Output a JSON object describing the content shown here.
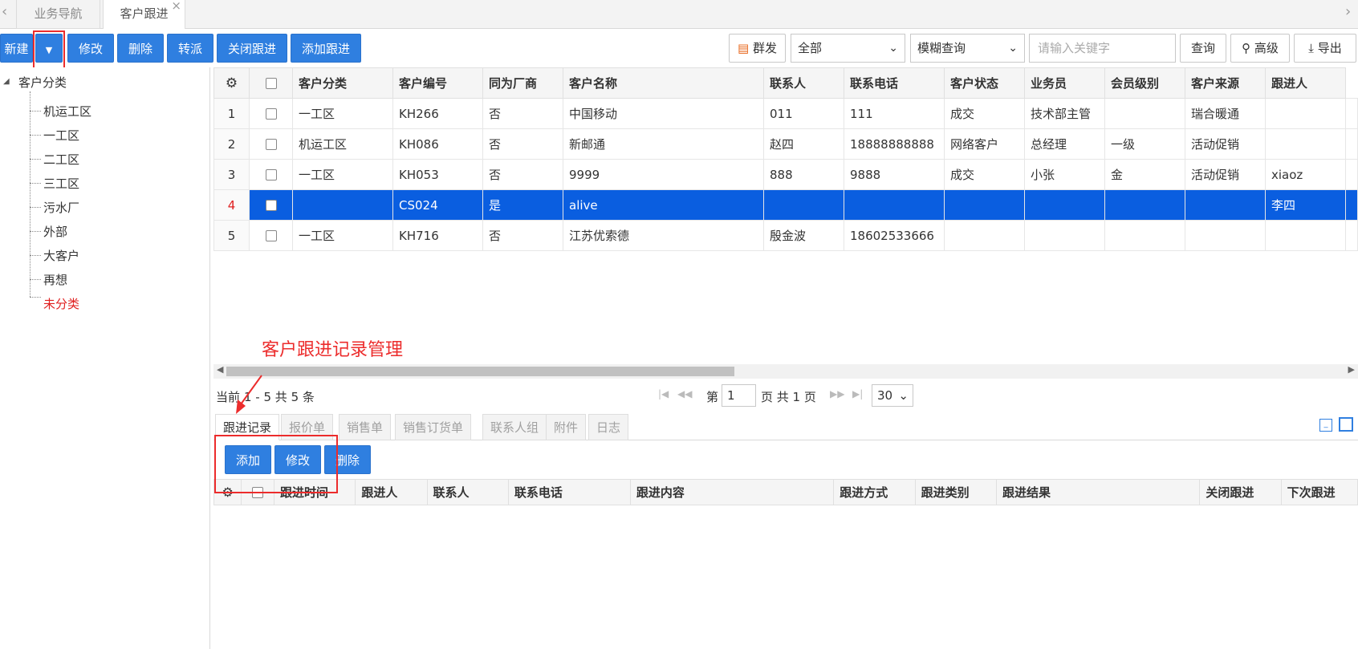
{
  "tabs": [
    {
      "label": "业务导航"
    },
    {
      "label": "客户跟进"
    }
  ],
  "toolbar": {
    "new": "新建",
    "edit": "修改",
    "delete": "删除",
    "transfer": "转派",
    "close_follow": "关闭跟进",
    "add_follow": "添加跟进",
    "mass_send": "群发",
    "scope_select": "全部",
    "query_mode_select": "模糊查询",
    "keyword_placeholder": "请输入关键字",
    "query": "查询",
    "advanced": "高级",
    "export": "导出"
  },
  "tree": {
    "root": "客户分类",
    "items": [
      "机运工区",
      "一工区",
      "二工区",
      "三工区",
      "污水厂",
      "外部",
      "大客户",
      "再想",
      "未分类"
    ]
  },
  "grid": {
    "columns": [
      "客户分类",
      "客户编号",
      "同为厂商",
      "客户名称",
      "联系人",
      "联系电话",
      "客户状态",
      "业务员",
      "会员级别",
      "客户来源",
      "跟进人"
    ],
    "rows": [
      {
        "num": "1",
        "cells": [
          "一工区",
          "KH266",
          "否",
          "中国移动",
          "011",
          "111",
          "成交",
          "技术部主管",
          "",
          "瑞合暖通",
          ""
        ]
      },
      {
        "num": "2",
        "cells": [
          "机运工区",
          "KH086",
          "否",
          "新邮通",
          "赵四",
          "18888888888",
          "网络客户",
          "总经理",
          "一级",
          "活动促销",
          ""
        ]
      },
      {
        "num": "3",
        "cells": [
          "一工区",
          "KH053",
          "否",
          "9999",
          "888",
          "9888",
          "成交",
          "小张",
          "金",
          "活动促销",
          "xiaoz"
        ]
      },
      {
        "num": "4",
        "cells": [
          "",
          "CS024",
          "是",
          "alive",
          "",
          "",
          "",
          "",
          "",
          "",
          "李四"
        ]
      },
      {
        "num": "5",
        "cells": [
          "一工区",
          "KH716",
          "否",
          "江苏优索德",
          "殷金波",
          "18602533666",
          "",
          "",
          "",
          "",
          ""
        ]
      }
    ]
  },
  "pager": {
    "summary_prefix": "当前",
    "summary_range": "1 - 5 共 5 条",
    "page_label": "第",
    "page_value": "1",
    "page_suffix": "页 共 1 页",
    "page_size": "30"
  },
  "annotation": "客户跟进记录管理",
  "bottom": {
    "tabs": [
      "跟进记录",
      "报价单",
      "销售单",
      "销售订货单",
      "联系人组",
      "附件",
      "日志"
    ],
    "add": "添加",
    "edit": "修改",
    "delete": "删除",
    "columns": [
      "跟进时间",
      "跟进人",
      "联系人",
      "联系电话",
      "跟进内容",
      "跟进方式",
      "跟进类别",
      "跟进结果",
      "关闭跟进",
      "下次跟进"
    ]
  },
  "colors": {
    "primary": "#2f7fe0",
    "selected_row": "#0a5ee0",
    "annotation": "#ec2c2c"
  }
}
